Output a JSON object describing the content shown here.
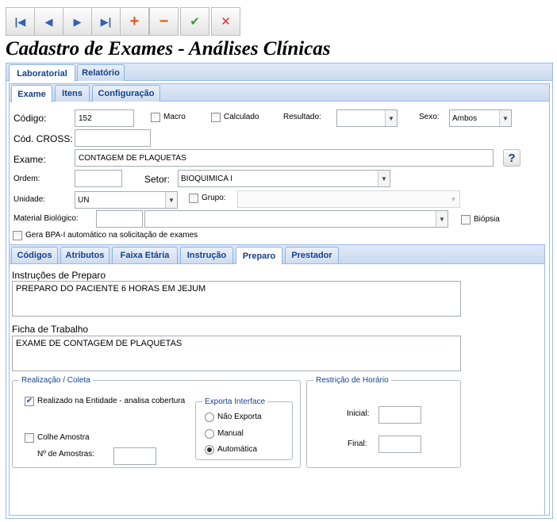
{
  "toolbar": {
    "first_icon": "|◀",
    "prev_icon": "◀",
    "next_icon": "▶",
    "last_icon": "▶|",
    "add_icon": "+",
    "remove_icon": "−",
    "confirm_icon": "✔",
    "cancel_icon": "✕"
  },
  "page_title": "Cadastro de Exames - Análises Clínicas",
  "main_tabs": [
    "Laboratorial",
    "Relatório"
  ],
  "sub_tabs": [
    "Exame",
    "Itens",
    "Configuração"
  ],
  "form": {
    "codigo_label": "Código:",
    "codigo_value": "152",
    "macro_label": "Macro",
    "calculado_label": "Calculado",
    "resultado_label": "Resultado:",
    "resultado_value": "",
    "sexo_label": "Sexo:",
    "sexo_value": "Ambos",
    "cod_cross_label": "Cód. CROSS:",
    "cod_cross_value": "",
    "exame_label": "Exame:",
    "exame_value": "CONTAGEM DE PLAQUETAS",
    "help_icon": "?",
    "ordem_label": "Ordem:",
    "ordem_value": "",
    "setor_label": "Setor:",
    "setor_value": "BIOQUIMICA I",
    "unidade_label": "Unidade:",
    "unidade_value": "UN",
    "grupo_label": "Grupo:",
    "grupo_value": "",
    "material_label": "Material Biológico:",
    "material_code": "",
    "material_value": "",
    "biopsia_label": "Biópsia",
    "bpa_label": "Gera BPA-I automático na solicitação de exames"
  },
  "detail_tabs": [
    "Códigos",
    "Atributos",
    "Faixa Etária",
    "Instrução",
    "Preparo",
    "Prestador"
  ],
  "preparo": {
    "instrucoes_label": "Instruções de Preparo",
    "instrucoes_value": "PREPARO DO PACIENTE 6 HORAS EM JEJUM",
    "ficha_label": "Ficha de Trabalho",
    "ficha_value": "EXAME DE CONTAGEM DE PLAQUETAS"
  },
  "realizacao": {
    "legend": "Realização / Coleta",
    "realizado_label": "Realizado na Entidade - analisa cobertura",
    "colhe_label": "Colhe Amostra",
    "num_amostras_label": "Nº de Amostras:",
    "num_amostras_value": "",
    "exporta_legend": "Exporta Interface",
    "exporta_options": [
      "Não Exporta",
      "Manual",
      "Automática"
    ]
  },
  "restricao": {
    "legend": "Restrição de Horário",
    "inicial_label": "Inicial:",
    "inicial_value": "",
    "final_label": "Final:",
    "final_value": ""
  },
  "state": {
    "active_main_tab": "Laboratorial",
    "active_sub_tab": "Exame",
    "active_detail_tab": "Preparo",
    "macro": false,
    "calculado": false,
    "biopsia": false,
    "gera_bpa": false,
    "realizado_na_entidade": true,
    "colhe_amostra": false,
    "exporta_interface": "Automática"
  },
  "colors": {
    "tab_text": "#15428b",
    "panel_border": "#99bbe8",
    "add_icon": "#e25b1a",
    "remove_icon": "#e05a1c",
    "confirm_icon": "#2f9a2f",
    "cancel_icon": "#d9342b",
    "nav_icon": "#2f62b8"
  },
  "icons": {
    "first": "first-record-icon",
    "prev": "previous-record-icon",
    "next": "next-record-icon",
    "last": "last-record-icon",
    "add": "plus-icon",
    "remove": "minus-icon",
    "confirm": "checkmark-icon",
    "cancel": "close-icon",
    "help": "help-icon",
    "dropdown": "chevron-down-icon"
  }
}
